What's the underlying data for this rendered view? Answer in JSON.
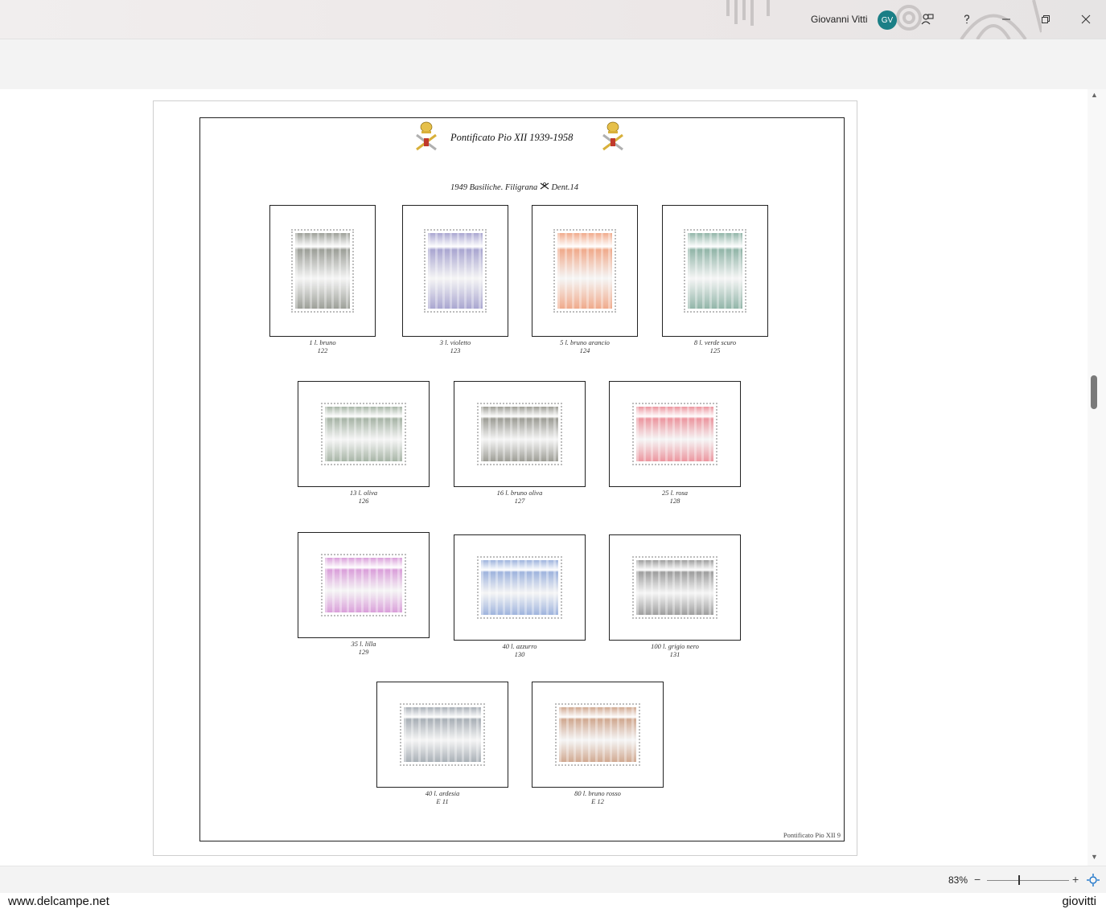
{
  "titlebar": {
    "user_name": "Giovanni Vitti",
    "avatar_initials": "GV",
    "avatar_color": "#1b7f86",
    "icons": [
      "feedback-icon",
      "help-icon",
      "minimize-icon",
      "restore-icon",
      "close-icon"
    ]
  },
  "document": {
    "title": "Pontificato Pio XII   1939-1958",
    "subtitle": "1949 Basiliche. Filigrana",
    "subtitle_suffix": "Dent.14",
    "footer_ref": "Pontificato Pio XII 9",
    "stamps": [
      {
        "desc": "1 l. bruno",
        "num": "122",
        "color": "#8c8f87"
      },
      {
        "desc": "3 l. violetto",
        "num": "123",
        "color": "#9b97c9"
      },
      {
        "desc": "5 l. bruno arancio",
        "num": "124",
        "color": "#ee9c78"
      },
      {
        "desc": "8 l. verde scuro",
        "num": "125",
        "color": "#7fa99a"
      },
      {
        "desc": "13 l. oliva",
        "num": "126",
        "color": "#98a897"
      },
      {
        "desc": "16 l. bruno oliva",
        "num": "127",
        "color": "#8d8d84"
      },
      {
        "desc": "25 l. rosa",
        "num": "128",
        "color": "#e9848f"
      },
      {
        "desc": "35 l. lilla",
        "num": "129",
        "color": "#d48fd4"
      },
      {
        "desc": "40 l. azzurro",
        "num": "130",
        "color": "#8ea7d8"
      },
      {
        "desc": "100 l. grigio nero",
        "num": "131",
        "color": "#8d8d8d"
      },
      {
        "desc": "40 l. ardesia",
        "num": "E 11",
        "color": "#9aa2aa"
      },
      {
        "desc": "80 l. bruno rosso",
        "num": "E 12",
        "color": "#c99a7e"
      }
    ]
  },
  "zoom": {
    "label": "83%",
    "minus": "−",
    "plus": "+",
    "level_percent": 83
  },
  "watermark": {
    "left": "www.delcampe.net",
    "right": "giovitti"
  }
}
